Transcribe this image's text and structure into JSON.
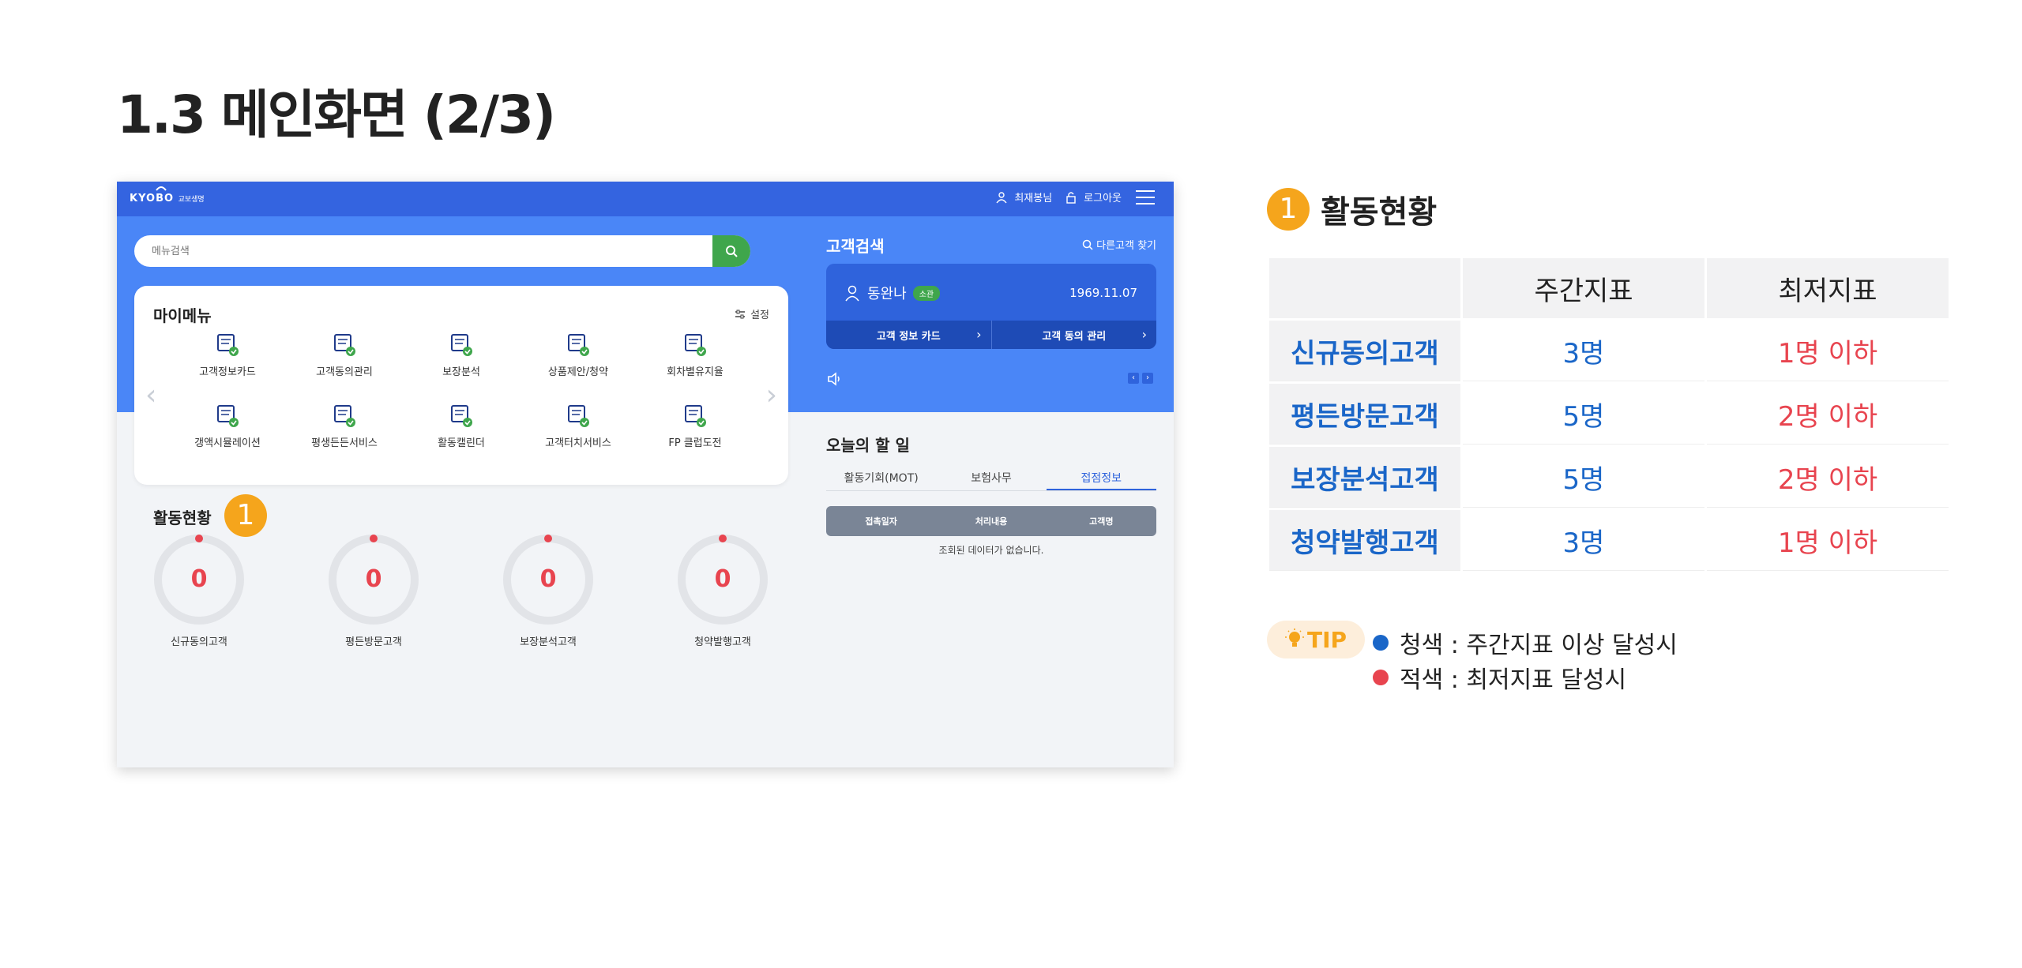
{
  "page_title": "1.3 메인화면 (2/3)",
  "app": {
    "logo_text": "KYOBO",
    "logo_sub": "교보생명",
    "user_name": "최재봉님",
    "logout": "로그아웃",
    "search_placeholder": "메뉴검색",
    "mymenu": {
      "title": "마이메뉴",
      "settings": "설정",
      "items": [
        {
          "label": "고객정보카드",
          "icon": "customer-card-icon"
        },
        {
          "label": "고객동의관리",
          "icon": "consent-doc-icon"
        },
        {
          "label": "보장분석",
          "icon": "coverage-analysis-icon"
        },
        {
          "label": "상품제안/청약",
          "icon": "product-proposal-icon"
        },
        {
          "label": "회차별유지율",
          "icon": "retention-chart-icon"
        },
        {
          "label": "갱액시뮬레이션",
          "icon": "simulation-icon"
        },
        {
          "label": "평생든든서비스",
          "icon": "lifetime-service-icon"
        },
        {
          "label": "활동캘린더",
          "icon": "calendar-icon"
        },
        {
          "label": "고객터치서비스",
          "icon": "touch-service-icon"
        },
        {
          "label": "FP 클럽도전",
          "icon": "club-target-icon"
        }
      ]
    },
    "activity": {
      "title": "활동현황",
      "badge": "1",
      "gauges": [
        {
          "label": "신규동의고객",
          "value": "0"
        },
        {
          "label": "평든방문고객",
          "value": "0"
        },
        {
          "label": "보장분석고객",
          "value": "0"
        },
        {
          "label": "청약발행고객",
          "value": "0"
        }
      ]
    },
    "customer_search": {
      "title": "고객검색",
      "other_search": "다른고객 찾기",
      "customer_name": "동완나",
      "customer_tag": "소관",
      "birth": "1969.11.07",
      "btn_card": "고객 정보 카드",
      "btn_consent": "고객 동의 관리"
    },
    "todo": {
      "title": "오늘의 할 일",
      "tabs": [
        "활동기회(MOT)",
        "보험사무",
        "접점정보"
      ],
      "active_tab": 2,
      "columns": [
        "접촉일자",
        "처리내용",
        "고객명"
      ],
      "empty_text": "조회된 데이터가 없습니다."
    }
  },
  "panel": {
    "badge": "1",
    "title": "활동현황",
    "headers": [
      "",
      "주간지표",
      "최저지표"
    ],
    "rows": [
      {
        "name": "신규동의고객",
        "weekly": "3명",
        "minimum": "1명 이하"
      },
      {
        "name": "평든방문고객",
        "weekly": "5명",
        "minimum": "2명 이하"
      },
      {
        "name": "보장분석고객",
        "weekly": "5명",
        "minimum": "2명 이하"
      },
      {
        "name": "청약발행고객",
        "weekly": "3명",
        "minimum": "1명 이하"
      }
    ],
    "tip_label": "TIP",
    "legend": [
      {
        "text": "청색 : 주간지표 이상 달성시",
        "color": "#1a66c8"
      },
      {
        "text": "적색 : 최저지표 달성시",
        "color": "#e8444f"
      }
    ]
  },
  "colors": {
    "accent_blue": "#3464e0",
    "green": "#3fa64c",
    "orange": "#f5a51c",
    "red": "#e8444f"
  }
}
